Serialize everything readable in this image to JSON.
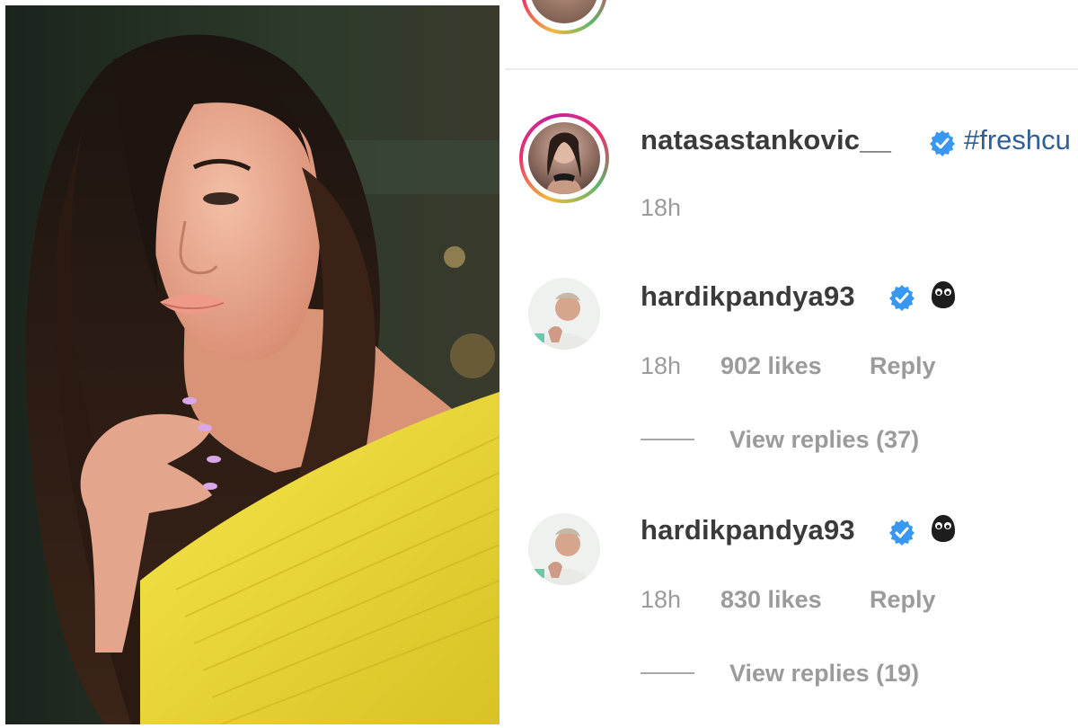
{
  "post": {
    "author": "natasastankovic__",
    "caption": "#freshcu",
    "time": "18h"
  },
  "comments": [
    {
      "username": "hardikpandya93",
      "emoji": "dark-face-emoji",
      "time": "18h",
      "likes": "902 likes",
      "reply": "Reply",
      "view_replies": "View replies (37)"
    },
    {
      "username": "hardikpandya93",
      "emoji": "dark-face-emoji",
      "time": "18h",
      "likes": "830 likes",
      "reply": "Reply",
      "view_replies": "View replies (19)"
    }
  ],
  "colors": {
    "verified": "#3897f0",
    "hashtag": "#2f5f95",
    "username": "#3a3a3a",
    "muted": "#9b9b9b",
    "dress": "#f2e03a"
  },
  "icons": [
    "verified-badge-icon",
    "dark-face-emoji-icon"
  ]
}
